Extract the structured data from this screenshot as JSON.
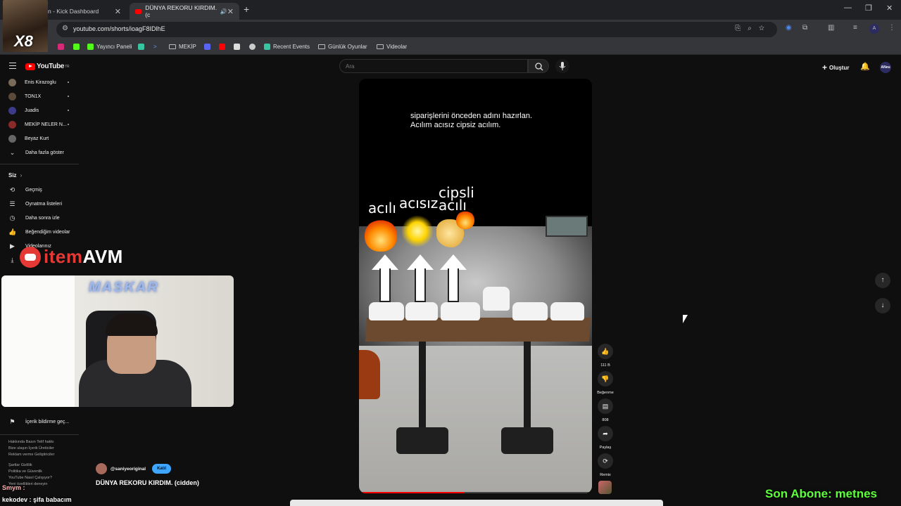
{
  "browser": {
    "tabs": [
      {
        "title": "n - Kick Dashboard",
        "active": false
      },
      {
        "title": "DÜNYA REKORU KIRDIM. (c",
        "active": true
      }
    ],
    "url": "youtube.com/shorts/ioagF8IDlhE",
    "overlay_badge": "X8"
  },
  "bookmarks": [
    {
      "label": "",
      "icon": "x-icon"
    },
    {
      "label": "",
      "icon": "instagram-icon"
    },
    {
      "label": "Yayıncı Paneli",
      "icon": "kick-icon"
    },
    {
      "label": "",
      "icon": "app-icon"
    },
    {
      "label": "",
      "icon": "terminal-icon"
    },
    {
      "label": "MEKİP",
      "icon": "folder-icon"
    },
    {
      "label": "",
      "icon": "discord-icon"
    },
    {
      "label": "",
      "icon": "youtube-icon"
    },
    {
      "label": "",
      "icon": "image-icon"
    },
    {
      "label": "",
      "icon": "ring-icon"
    },
    {
      "label": "Recent Events",
      "icon": "events-icon"
    },
    {
      "label": "Günlük Oyunlar",
      "icon": "folder-icon"
    },
    {
      "label": "Videolar",
      "icon": "folder-icon"
    }
  ],
  "youtube": {
    "logo": "YouTube",
    "logo_region": "TR",
    "search_placeholder": "Ara",
    "create_label": "Oluştur",
    "account_initials": "ANeu"
  },
  "sidebar": {
    "subscriptions": [
      {
        "name": "Enis Kirazoglu"
      },
      {
        "name": "TON1X"
      },
      {
        "name": "Juadis"
      },
      {
        "name": "MEKİP NELER N..."
      },
      {
        "name": "Beyaz Kurt"
      }
    ],
    "show_more": "Daha fazla göster",
    "you_header": "Siz",
    "you_items": [
      {
        "label": "Geçmiş",
        "icon": "history-icon"
      },
      {
        "label": "Oynatma listeleri",
        "icon": "playlist-icon"
      },
      {
        "label": "Daha sonra izle",
        "icon": "clock-icon"
      },
      {
        "label": "Beğendiğim videolar",
        "icon": "like-icon"
      },
      {
        "label": "Videolarınız",
        "icon": "video-icon"
      },
      {
        "label": "",
        "icon": "download-icon"
      }
    ],
    "report_history": "İçerik bildirme geç...",
    "footer_lines": [
      "Hakkında  Basın  Telif hakkı",
      "Bize ulaşın  İçerik Üreticiler",
      "Reklam verme  Geliştiriciler",
      "",
      "Şartlar  Gizlilik",
      "Politika ve Güvenlik",
      "YouTube Nasıl Çalışıyor?",
      "Yeni özellikleri deneyin"
    ]
  },
  "overlay": {
    "sponsor_prefix": "item",
    "sponsor_suffix": "AVM",
    "webcam_name": "MASKAR",
    "chat": [
      {
        "user": "Smym :",
        "message": ""
      },
      {
        "user": "kekodev :",
        "message": "şifa babacım"
      }
    ],
    "last_subscriber": "Son Abone: metnes"
  },
  "short": {
    "caption_lines": [
      "siparişlerini önceden adını hazırlan.",
      "Acılım acısız cipsiz acılım."
    ],
    "stickers": [
      "acılı",
      "acısız",
      "cipsli",
      "acılı"
    ],
    "progress": 0.45,
    "channel": "@saniyeoriginal",
    "join_label": "Katıl",
    "title": "DÜNYA REKORU KIRDIM. (cidden)",
    "actions": [
      {
        "label": "111 B",
        "icon": "like-icon"
      },
      {
        "label": "Beğenme",
        "icon": "dislike-icon"
      },
      {
        "label": "808",
        "icon": "comment-icon"
      },
      {
        "label": "Paylaş",
        "icon": "share-icon"
      },
      {
        "label": "Remix",
        "icon": "remix-icon"
      }
    ]
  }
}
